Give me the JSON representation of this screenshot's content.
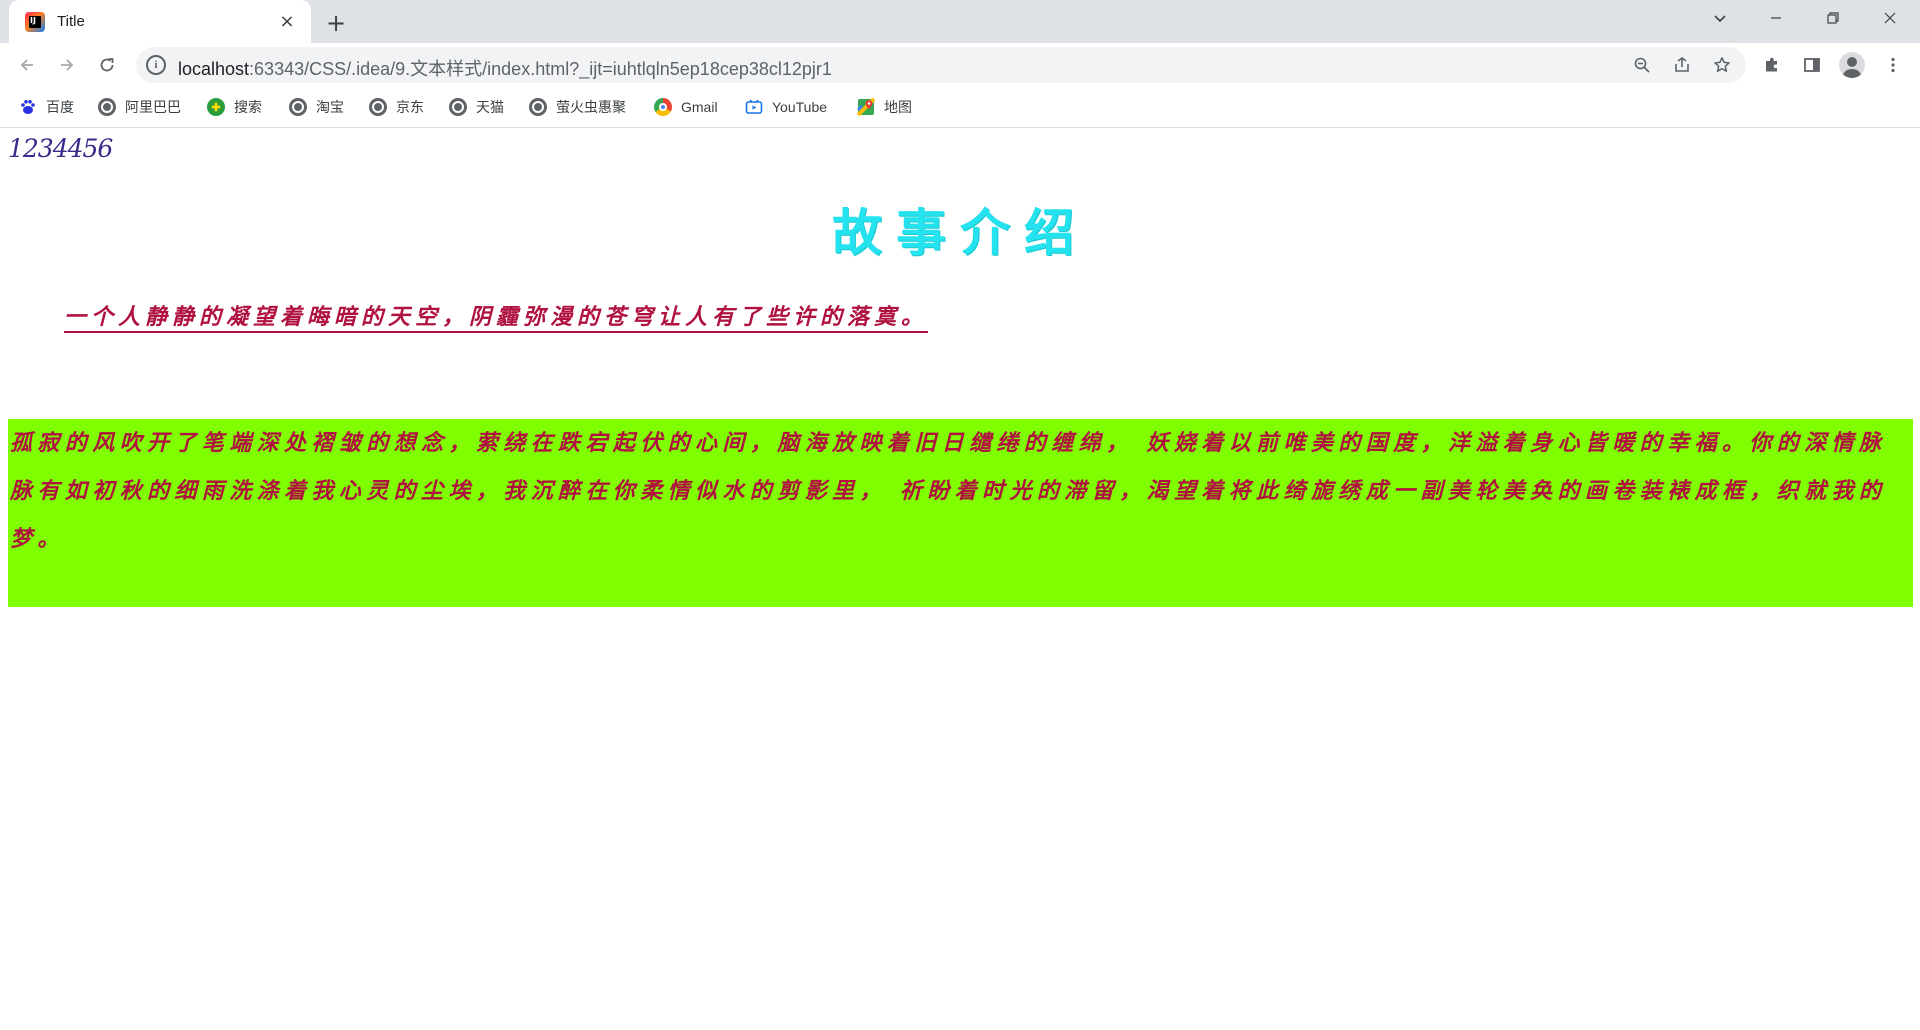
{
  "browser": {
    "tab_title": "Title",
    "tab_close_glyph": "×",
    "new_tab_glyph": "+",
    "url_host": "localhost",
    "url_path": ":63343/CSS/.idea/9.文本样式/index.html?_ijt=iuhtlqln5ep18cep38cl12pjr1",
    "bookmarks": [
      {
        "label": "百度",
        "icon": "baidu-icon"
      },
      {
        "label": "阿里巴巴",
        "icon": "globe-icon"
      },
      {
        "label": "搜索",
        "icon": "search-engine-icon"
      },
      {
        "label": "淘宝",
        "icon": "globe-icon"
      },
      {
        "label": "京东",
        "icon": "globe-icon"
      },
      {
        "label": "天猫",
        "icon": "globe-icon"
      },
      {
        "label": "萤火虫惠聚",
        "icon": "globe-icon"
      },
      {
        "label": "Gmail",
        "icon": "chrome-icon"
      },
      {
        "label": "YouTube",
        "icon": "youtube-icon"
      },
      {
        "label": "地图",
        "icon": "maps-icon"
      }
    ]
  },
  "page": {
    "top_number": "1234456",
    "title": "故事介绍",
    "subtitle": "一个人静静的凝望着晦暗的天空，阴霾弥漫的苍穹让人有了些许的落寞。",
    "paragraph": "孤寂的风吹开了笔端深处褶皱的想念，萦绕在跌宕起伏的心间，脑海放映着旧日缱绻的缠绵， 妖娆着以前唯美的国度，洋溢着身心皆暖的幸福。你的深情脉脉有如初秋的细雨洗涤着我心灵的尘埃，我沉醉在你柔情似水的剪影里， 祈盼着时光的滞留，渴望着将此绮旎绣成一副美轮美奂的画卷装裱成框，织就我的梦。"
  },
  "colors": {
    "title": "#25e3ee",
    "text_red": "#b0123f",
    "paragraph_bg": "#7fff00",
    "top_number": "#3a2a8a"
  }
}
